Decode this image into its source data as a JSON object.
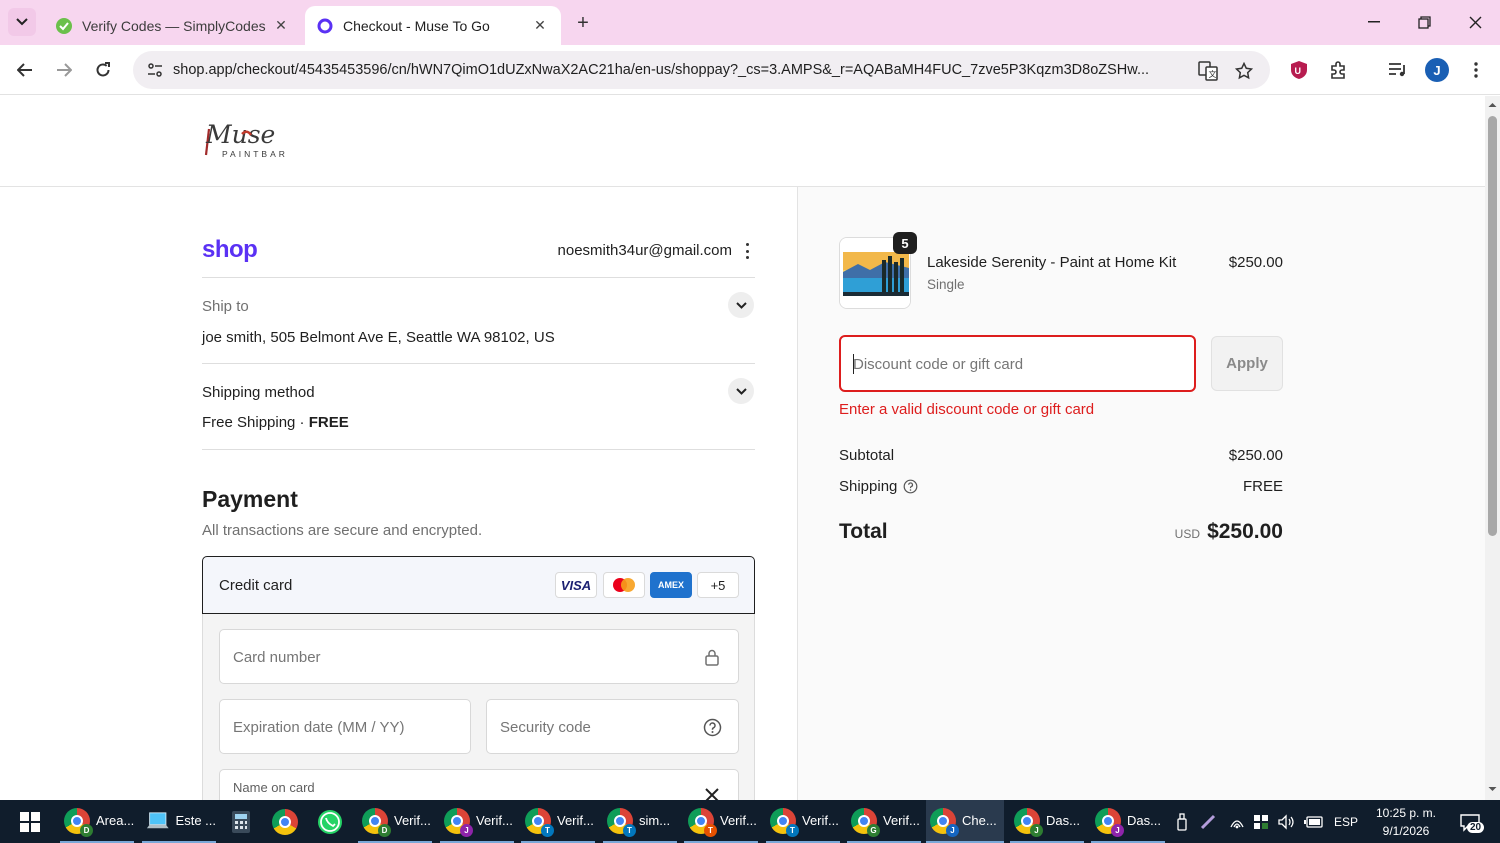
{
  "browser": {
    "tabs": [
      {
        "title": "Verify Codes — SimplyCodes",
        "active": false
      },
      {
        "title": "Checkout - Muse To Go",
        "active": true
      }
    ],
    "url": "shop.app/checkout/45435453596/cn/hWN7QimO1dUZxNwaX2AC21ha/en-us/shoppay?_cs=3.AMPS&_r=AQABaMH4FUC_7zve5P3Kqzm3D8oZSHw...",
    "profile_initial": "J"
  },
  "store": {
    "logo_text": "Muse",
    "logo_sub": "PAINTBAR"
  },
  "checkout": {
    "shop_brand": "shop",
    "email": "noesmith34ur@gmail.com",
    "ship_to": {
      "label": "Ship to",
      "address": "joe smith, 505 Belmont Ave E, Seattle WA 98102, US"
    },
    "shipping_method": {
      "label": "Shipping method",
      "value": "Free Shipping · ",
      "value_bold": "FREE"
    },
    "payment": {
      "heading": "Payment",
      "subtitle": "All transactions are secure and encrypted.",
      "method_label": "Credit card",
      "card_brands": [
        "VISA",
        "AMEX",
        "+5"
      ],
      "fields": {
        "card_number": "Card number",
        "expiration": "Expiration date (MM / YY)",
        "security_code": "Security code",
        "name_on_card": "Name on card"
      }
    }
  },
  "summary": {
    "product": {
      "name": "Lakeside Serenity - Paint at Home Kit",
      "variant": "Single",
      "price": "$250.00",
      "quantity": "5"
    },
    "discount": {
      "placeholder": "Discount code or gift card",
      "apply_label": "Apply",
      "error": "Enter a valid discount code or gift card"
    },
    "subtotal_label": "Subtotal",
    "subtotal": "$250.00",
    "shipping_label": "Shipping",
    "shipping": "FREE",
    "total_label": "Total",
    "currency": "USD",
    "total": "$250.00"
  },
  "taskbar": {
    "items": [
      {
        "label": "Area...",
        "badge": "D",
        "badge_color": "#2e7d32"
      },
      {
        "label": "Este ..."
      },
      {
        "label": ""
      },
      {
        "label": ""
      },
      {
        "label": ""
      },
      {
        "label": "Verif...",
        "badge": "D",
        "badge_color": "#2e7d32"
      },
      {
        "label": "Verif...",
        "badge": "J",
        "badge_color": "#8e24aa"
      },
      {
        "label": "Verif...",
        "badge": "T",
        "badge_color": "#0277bd"
      },
      {
        "label": "sim...",
        "badge": "T",
        "badge_color": "#0277bd"
      },
      {
        "label": "Verif...",
        "badge": "T",
        "badge_color": "#e65100"
      },
      {
        "label": "Verif...",
        "badge": "T",
        "badge_color": "#0277bd"
      },
      {
        "label": "Verif...",
        "badge": "G",
        "badge_color": "#2e7d32"
      },
      {
        "label": "Che...",
        "badge": "J",
        "badge_color": "#1565c0"
      },
      {
        "label": "Das...",
        "badge": "J",
        "badge_color": "#2e7d32"
      },
      {
        "label": "Das...",
        "badge": "J",
        "badge_color": "#8e24aa"
      }
    ],
    "language": "ESP",
    "time": "10:25 p. m.",
    "date": "9/1/2026",
    "notifications": "20"
  }
}
